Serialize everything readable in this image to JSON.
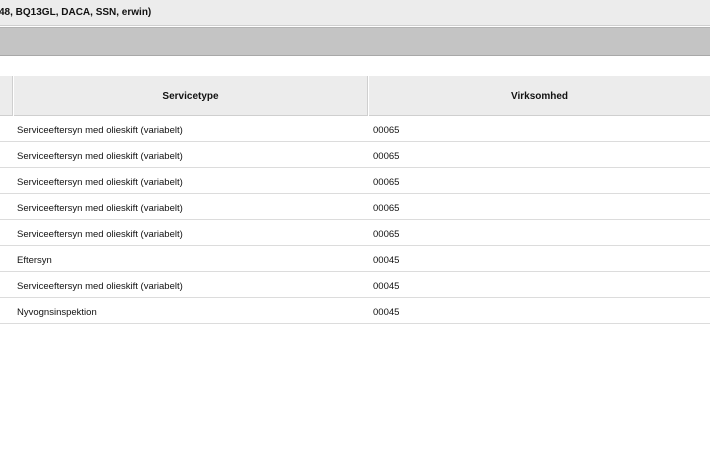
{
  "window": {
    "title": "48, BQ13GL, DACA, SSN, erwin)"
  },
  "table": {
    "columns": [
      "Servicetype",
      "Virksomhed"
    ],
    "rows": [
      {
        "servicetype": "Serviceeftersyn med olieskift (variabelt)",
        "virksomhed": "00065"
      },
      {
        "servicetype": "Serviceeftersyn med olieskift (variabelt)",
        "virksomhed": "00065"
      },
      {
        "servicetype": "Serviceeftersyn med olieskift (variabelt)",
        "virksomhed": "00065"
      },
      {
        "servicetype": "Serviceeftersyn med olieskift (variabelt)",
        "virksomhed": "00065"
      },
      {
        "servicetype": "Serviceeftersyn med olieskift (variabelt)",
        "virksomhed": "00065"
      },
      {
        "servicetype": "Eftersyn",
        "virksomhed": "00045"
      },
      {
        "servicetype": "Serviceeftersyn med olieskift (variabelt)",
        "virksomhed": "00045"
      },
      {
        "servicetype": "Nyvognsinspektion",
        "virksomhed": "00045"
      }
    ]
  }
}
